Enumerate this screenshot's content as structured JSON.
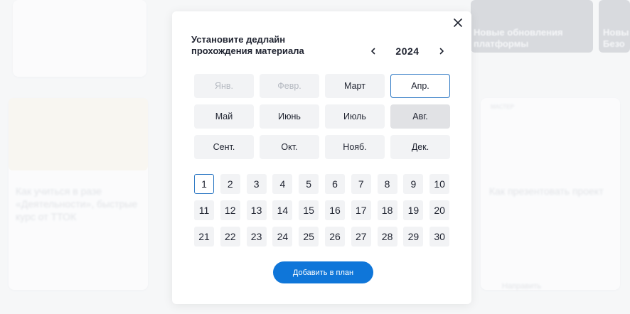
{
  "background": {
    "card_left_title": "Как учиться в разе «Деятельности», быстрые курс от ТТОК",
    "card_right_title": "Как презентовать проект",
    "banner_title": "Новые обновления платформы",
    "banner_right_title": "Новы Безо",
    "card_right_tag": "МАСТЕР",
    "bottom_link": "Направить"
  },
  "modal": {
    "title": "Установите дедлайн прохождения материала",
    "year": "2024",
    "months": [
      {
        "label": "Янв.",
        "state": "disabled"
      },
      {
        "label": "Февр.",
        "state": "disabled"
      },
      {
        "label": "Март",
        "state": "normal"
      },
      {
        "label": "Апр.",
        "state": "selected"
      },
      {
        "label": "Май",
        "state": "normal"
      },
      {
        "label": "Июнь",
        "state": "normal"
      },
      {
        "label": "Июль",
        "state": "normal"
      },
      {
        "label": "Авг.",
        "state": "hover"
      },
      {
        "label": "Сент.",
        "state": "normal"
      },
      {
        "label": "Окт.",
        "state": "normal"
      },
      {
        "label": "Нояб.",
        "state": "normal"
      },
      {
        "label": "Дек.",
        "state": "normal"
      }
    ],
    "days": [
      "1",
      "2",
      "3",
      "4",
      "5",
      "6",
      "7",
      "8",
      "9",
      "10",
      "11",
      "12",
      "13",
      "14",
      "15",
      "16",
      "17",
      "18",
      "19",
      "20",
      "21",
      "22",
      "23",
      "24",
      "25",
      "26",
      "27",
      "28",
      "29",
      "30"
    ],
    "selected_day": "1",
    "add_button_label": "Добавить в план"
  },
  "colors": {
    "accent": "#0f76d9",
    "selected_border": "#2d78c4",
    "cell_bg": "#f2f3f5",
    "text": "#1f2330"
  }
}
